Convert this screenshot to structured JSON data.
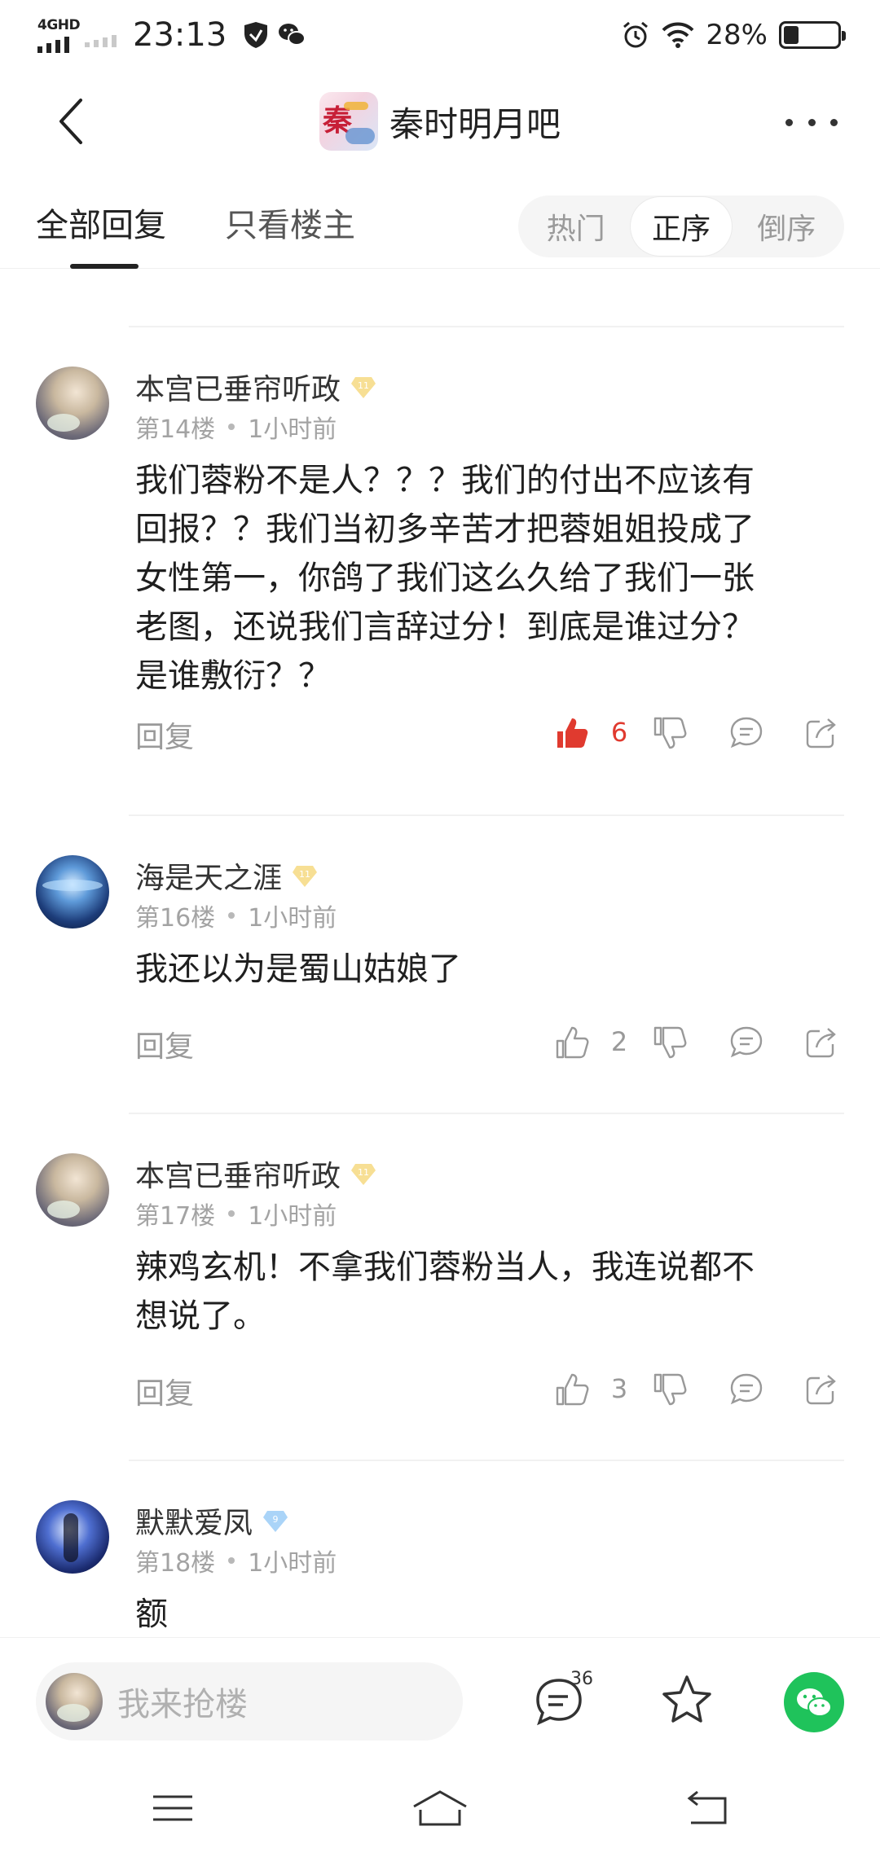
{
  "status_bar": {
    "network": "4GHD",
    "time": "23:13",
    "battery_text": "28%",
    "battery_level": 0.28
  },
  "title_bar": {
    "forum_name": "秦时明月吧"
  },
  "tabs": {
    "all_replies": "全部回复",
    "owner_only": "只看楼主",
    "sort": [
      "热门",
      "正序",
      "倒序"
    ],
    "sort_active": "正序"
  },
  "posts": [
    {
      "username": "本宫已垂帘听政",
      "level": "11",
      "floor": "第14楼",
      "time": "1小时前",
      "content": "我们蓉粉不是人？？？我们的付出不应该有\n回报？？我们当初多辛苦才把蓉姐姐投成了\n女性第一，你鸽了我们这么久给了我们一张\n老图，还说我们言辞过分！到底是谁过分？\n是谁敷衍？？",
      "reply_label": "回复",
      "likes": "6",
      "liked": true
    },
    {
      "username": "海是天之涯",
      "level": "11",
      "floor": "第16楼",
      "time": "1小时前",
      "content": "我还以为是蜀山姑娘了",
      "reply_label": "回复",
      "likes": "2",
      "liked": false
    },
    {
      "username": "本宫已垂帘听政",
      "level": "11",
      "floor": "第17楼",
      "time": "1小时前",
      "content": "辣鸡玄机！不拿我们蓉粉当人，我连说都不\n想说了。",
      "reply_label": "回复",
      "likes": "3",
      "liked": false
    },
    {
      "username": "默默爱凤",
      "level": "9",
      "floor": "第18楼",
      "time": "1小时前",
      "content": "额"
    }
  ],
  "bottom_bar": {
    "input_placeholder": "我来抢楼",
    "comment_count": "36"
  },
  "colors": {
    "like_red": "#e03a2f",
    "gold_badge": "#f2c94c",
    "blue_badge": "#8ec5f5",
    "wechat_green": "#1fc35b"
  }
}
